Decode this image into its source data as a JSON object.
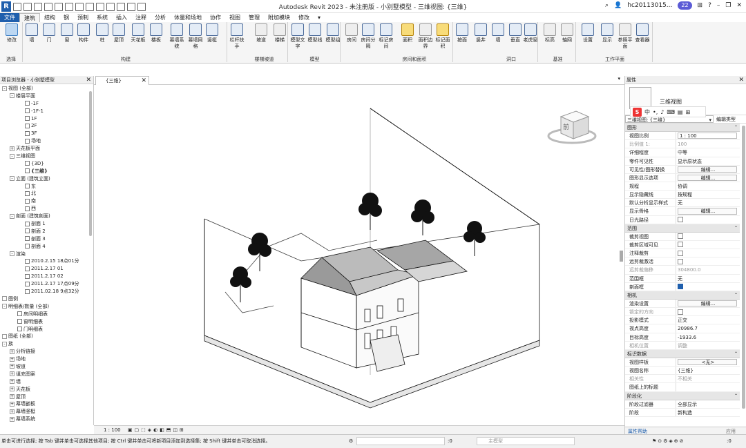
{
  "app": {
    "title": "Autodesk Revit 2023 - 未注册版 - 小别墅模型 - 三维视图: {三维}",
    "logo": "R",
    "user": "hc20113015...",
    "notify_count": "22"
  },
  "tabs": [
    "文件",
    "建筑",
    "结构",
    "钢",
    "预制",
    "系统",
    "插入",
    "注释",
    "分析",
    "体量和场地",
    "协作",
    "视图",
    "管理",
    "附加模块",
    "修改"
  ],
  "active_tab": "建筑",
  "ribbon": {
    "buttons": [
      "修改",
      "墙",
      "门",
      "窗",
      "构件",
      "柱",
      "屋顶",
      "天花板",
      "楼板",
      "幕墙系统",
      "幕墙网格",
      "竖梃",
      "栏杆扶手",
      "坡道",
      "楼梯",
      "模型文字",
      "模型线",
      "模型组",
      "房间",
      "房间分隔",
      "标记房间",
      "面积",
      "面积边界",
      "标记面积",
      "按面",
      "竖井",
      "墙",
      "垂直",
      "老虎窗",
      "标高",
      "轴网",
      "设置",
      "显示",
      "参照平面",
      "查看器"
    ],
    "groups": [
      "选择",
      "构建",
      "楼梯坡道",
      "模型",
      "房间和面积",
      "洞口",
      "基准",
      "工作平面"
    ]
  },
  "project_browser": {
    "title": "项目浏览器 - 小别墅模型",
    "items": [
      {
        "t": "视图 (全部)",
        "lvl": 0,
        "tg": "-"
      },
      {
        "t": "楼层平面",
        "lvl": 1,
        "tg": "-"
      },
      {
        "t": "-1F",
        "lvl": 3
      },
      {
        "t": "-1F-1",
        "lvl": 3
      },
      {
        "t": "1F",
        "lvl": 3
      },
      {
        "t": "2F",
        "lvl": 3
      },
      {
        "t": "3F",
        "lvl": 3
      },
      {
        "t": "场地",
        "lvl": 3
      },
      {
        "t": "天花板平面",
        "lvl": 1,
        "tg": "+"
      },
      {
        "t": "三维视图",
        "lvl": 1,
        "tg": "-"
      },
      {
        "t": "{3D}",
        "lvl": 3
      },
      {
        "t": "{三维}",
        "lvl": 3,
        "bold": true
      },
      {
        "t": "立面 (建筑立面)",
        "lvl": 1,
        "tg": "-"
      },
      {
        "t": "东",
        "lvl": 3
      },
      {
        "t": "北",
        "lvl": 3
      },
      {
        "t": "南",
        "lvl": 3
      },
      {
        "t": "西",
        "lvl": 3
      },
      {
        "t": "剖面 (建筑剖面)",
        "lvl": 1,
        "tg": "-"
      },
      {
        "t": "剖面 1",
        "lvl": 3
      },
      {
        "t": "剖面 2",
        "lvl": 3
      },
      {
        "t": "剖面 3",
        "lvl": 3
      },
      {
        "t": "剖面 4",
        "lvl": 3
      },
      {
        "t": "渲染",
        "lvl": 1,
        "tg": "-"
      },
      {
        "t": "2010.2.15  18点01分",
        "lvl": 3
      },
      {
        "t": "2011.2.17 01",
        "lvl": 3
      },
      {
        "t": "2011.2.17 02",
        "lvl": 3
      },
      {
        "t": "2011.2.17  17点09分",
        "lvl": 3
      },
      {
        "t": "2011.02.18  9点32分",
        "lvl": 3
      },
      {
        "t": "图例",
        "lvl": 0,
        "tg": ""
      },
      {
        "t": "明细表/数量 (全部)",
        "lvl": 0,
        "tg": "-"
      },
      {
        "t": "房间明细表",
        "lvl": 2
      },
      {
        "t": "窗明细表",
        "lvl": 2
      },
      {
        "t": "门明细表",
        "lvl": 2
      },
      {
        "t": "图纸 (全部)",
        "lvl": 0,
        "tg": ""
      },
      {
        "t": "族",
        "lvl": 0,
        "tg": "-"
      },
      {
        "t": "分析链接",
        "lvl": 1,
        "tg": "+"
      },
      {
        "t": "场地",
        "lvl": 1,
        "tg": "+"
      },
      {
        "t": "坡道",
        "lvl": 1,
        "tg": "+"
      },
      {
        "t": "填充图案",
        "lvl": 1,
        "tg": "+"
      },
      {
        "t": "墙",
        "lvl": 1,
        "tg": "+"
      },
      {
        "t": "天花板",
        "lvl": 1,
        "tg": "+"
      },
      {
        "t": "屋顶",
        "lvl": 1,
        "tg": "+"
      },
      {
        "t": "幕墙嵌板",
        "lvl": 1,
        "tg": "+"
      },
      {
        "t": "幕墙竖梃",
        "lvl": 1,
        "tg": "+"
      },
      {
        "t": "幕墙系统",
        "lvl": 1,
        "tg": "+"
      }
    ]
  },
  "view_tab": {
    "label": "{三维}"
  },
  "view_status": {
    "scale": "1 : 100"
  },
  "viewcube": {
    "face_label": "前"
  },
  "properties": {
    "title": "属性",
    "type_name": "三维视图",
    "selector": "三维视图: {三维}",
    "edit_type": "编辑类型",
    "sections": [
      {
        "name": "图形",
        "rows": [
          {
            "k": "视图比例",
            "v": "1 : 100",
            "box": true
          },
          {
            "k": "比例值 1:",
            "v": "100",
            "dim": true
          },
          {
            "k": "详细程度",
            "v": "中等"
          },
          {
            "k": "零件可见性",
            "v": "显示原状态"
          },
          {
            "k": "可见性/图形替换",
            "v": "编辑...",
            "btn": true
          },
          {
            "k": "图形显示选项",
            "v": "编辑...",
            "btn": true
          },
          {
            "k": "规程",
            "v": "协调"
          },
          {
            "k": "显示隐藏线",
            "v": "按规程"
          },
          {
            "k": "默认分析显示样式",
            "v": "无"
          },
          {
            "k": "显示骨格",
            "v": "编辑...",
            "btn": true
          },
          {
            "k": "日光路径",
            "cb": false
          }
        ]
      },
      {
        "name": "范围",
        "rows": [
          {
            "k": "裁剪视图",
            "cb": false
          },
          {
            "k": "裁剪区域可见",
            "cb": false
          },
          {
            "k": "注释裁剪",
            "cb": false
          },
          {
            "k": "远剪裁激活",
            "cb": false
          },
          {
            "k": "远剪裁偏移",
            "v": "304800.0",
            "dim": true
          },
          {
            "k": "范围框",
            "v": "无"
          },
          {
            "k": "剖面框",
            "cb": true
          }
        ]
      },
      {
        "name": "相机",
        "rows": [
          {
            "k": "渲染设置",
            "v": "编辑...",
            "btn": true
          },
          {
            "k": "锁定的方向",
            "cb": false,
            "dim": true
          },
          {
            "k": "投影模式",
            "v": "正交"
          },
          {
            "k": "视点高度",
            "v": "20986.7"
          },
          {
            "k": "目标高度",
            "v": "-1933.6"
          },
          {
            "k": "相机位置",
            "v": "调整",
            "dim": true
          }
        ]
      },
      {
        "name": "标识数据",
        "rows": [
          {
            "k": "视图样板",
            "v": "<无>",
            "btn": true
          },
          {
            "k": "视图名称",
            "v": "{三维}"
          },
          {
            "k": "相关性",
            "v": "不相关",
            "dim": true
          },
          {
            "k": "图纸上的标题",
            "v": ""
          }
        ]
      },
      {
        "name": "阶段化",
        "rows": [
          {
            "k": "阶段过滤器",
            "v": "全部显示"
          },
          {
            "k": "阶段",
            "v": "新构造"
          }
        ]
      }
    ],
    "help_link": "属性帮助",
    "apply_label": "应用"
  },
  "status": {
    "text": "单击可进行选择; 按 Tab 键并单击可选择其他项目; 按 Ctrl 键并单击可将新项目添加到选择集; 按 Shift 键并单击可取消选择。",
    "zero": ":0",
    "model": "主模型",
    "filter_count": ":0"
  },
  "colors": {
    "accent": "#1f5fad",
    "viewcube": "#e8e8e8"
  }
}
